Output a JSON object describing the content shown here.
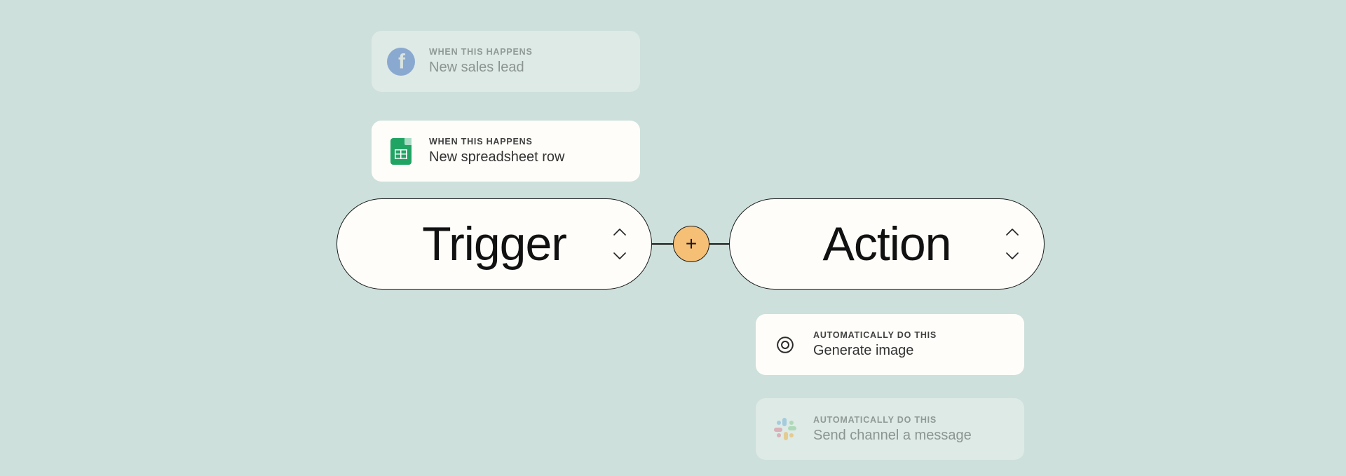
{
  "triggers": {
    "eyebrow": "WHEN THIS HAPPENS",
    "faded": {
      "label": "New sales lead",
      "icon": "facebook-icon"
    },
    "main": {
      "label": "New spreadsheet row",
      "icon": "google-sheets-icon"
    }
  },
  "actions": {
    "eyebrow": "AUTOMATICALLY DO THIS",
    "main": {
      "label": "Generate image",
      "icon": "openai-icon"
    },
    "faded": {
      "label": "Send channel a message",
      "icon": "slack-icon"
    }
  },
  "pills": {
    "trigger": "Trigger",
    "action": "Action"
  },
  "plus": "+"
}
